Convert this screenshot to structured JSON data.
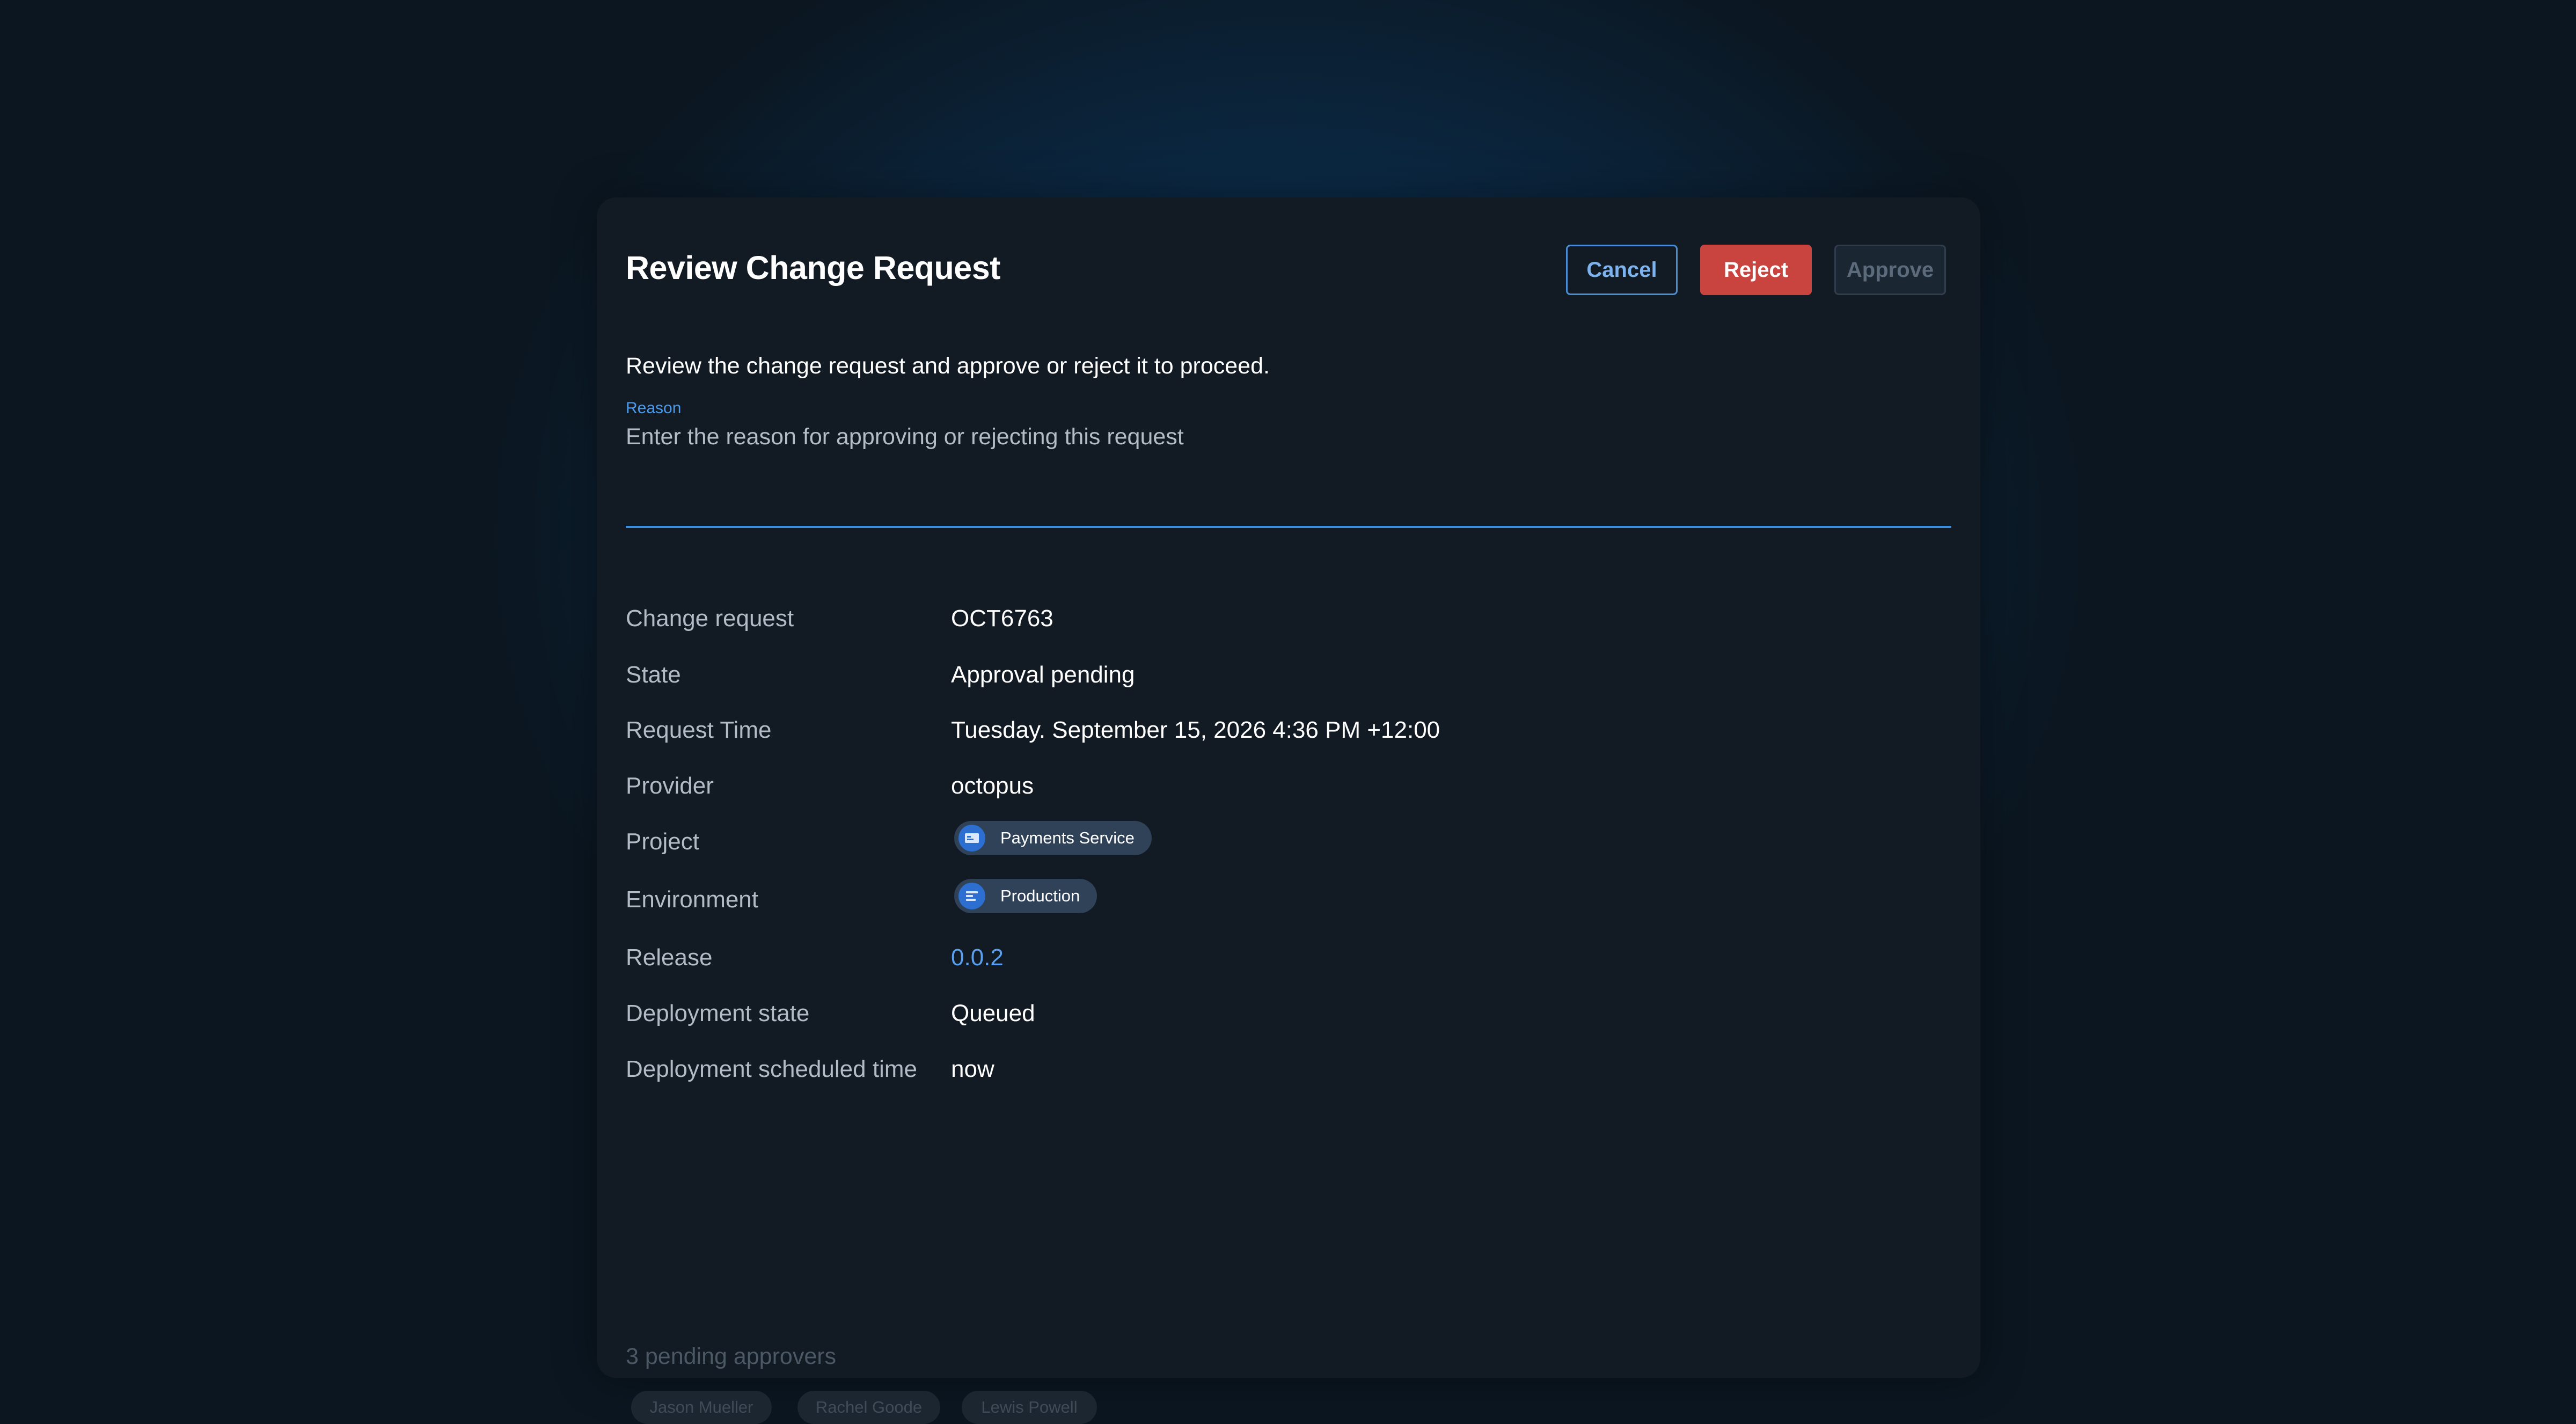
{
  "dialog": {
    "title": "Review Change Request",
    "description": "Review the change request and approve or reject it to proceed.",
    "buttons": {
      "cancel": "Cancel",
      "reject": "Reject",
      "approve": "Approve"
    },
    "reason": {
      "label": "Reason",
      "placeholder": "Enter the reason for approving or rejecting this request",
      "value": ""
    }
  },
  "details": [
    {
      "label": "Change request",
      "value": "OCT6763"
    },
    {
      "label": "State",
      "value": "Approval pending"
    },
    {
      "label": "Request Time",
      "value": "Tuesday. September 15, 2026 4:36 PM +12:00"
    },
    {
      "label": "Provider",
      "value": "octopus"
    },
    {
      "label": "Project",
      "value": "Payments Service",
      "icon": "project-card-icon"
    },
    {
      "label": "Environment",
      "value": "Production",
      "icon": "environment-bars-icon"
    },
    {
      "label": "Release",
      "value": "0.0.2"
    },
    {
      "label": "Deployment state",
      "value": "Queued"
    },
    {
      "label": "Deployment scheduled time",
      "value": "now"
    }
  ],
  "approvers": {
    "title": "3 pending approvers",
    "names": [
      "Jason Mueller",
      "Rachel Goode",
      "Lewis Powell"
    ]
  },
  "colors": {
    "background": "#0b1620",
    "card": "#121a23",
    "accent": "#3b8de0",
    "reject": "#c9443f",
    "link": "#5aa0f0"
  }
}
